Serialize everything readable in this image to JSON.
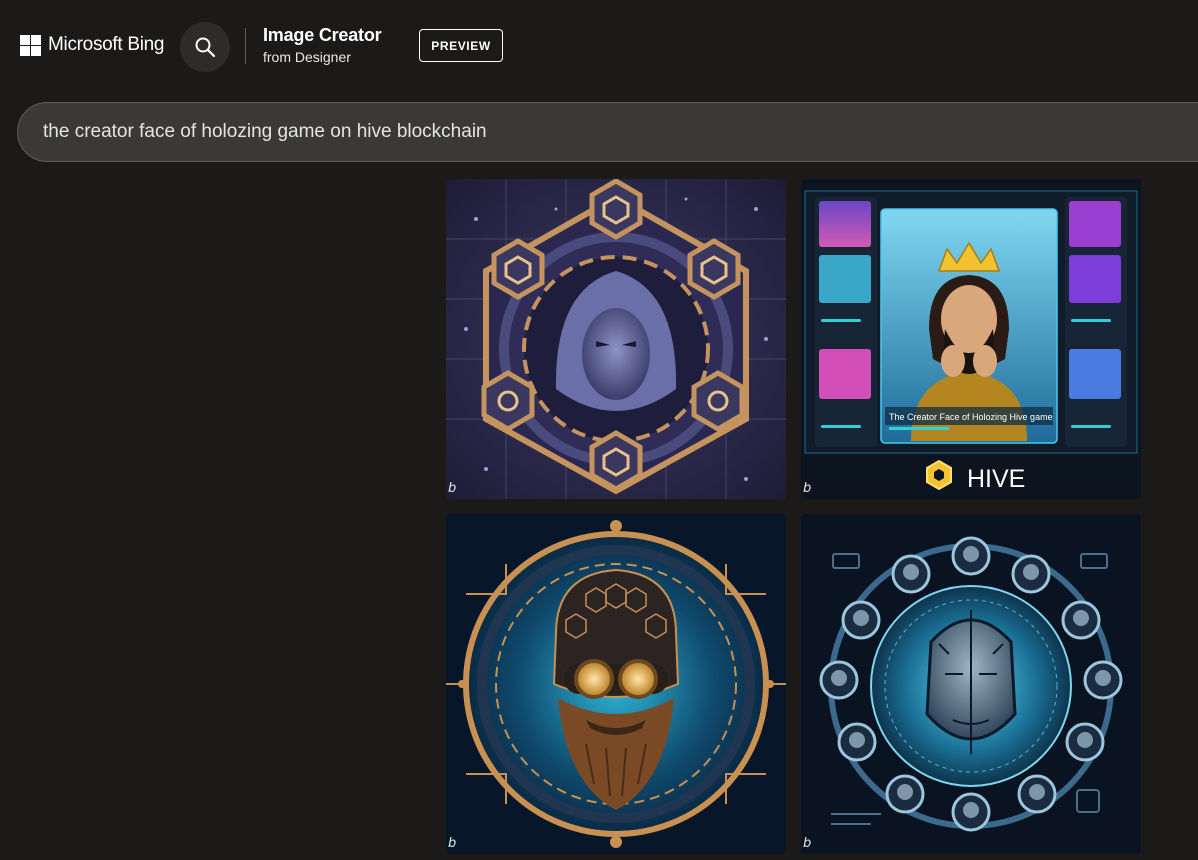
{
  "header": {
    "brand": "Microsoft Bing",
    "title": "Image Creator",
    "subtitle": "from Designer",
    "badge": "PREVIEW"
  },
  "prompt": {
    "value": "the creator face of holozing game on hive blockchain"
  },
  "images": {
    "mark": "b",
    "tile2_caption": "The Creator Face of Holozing Hive game",
    "tile2_hive": "HIVE"
  },
  "colors": {
    "background": "#1b1a19",
    "prompt_bg": "#3a3938",
    "hive_yellow": "#f2c230"
  },
  "icons": [
    "windows-logo-icon",
    "search-icon"
  ]
}
